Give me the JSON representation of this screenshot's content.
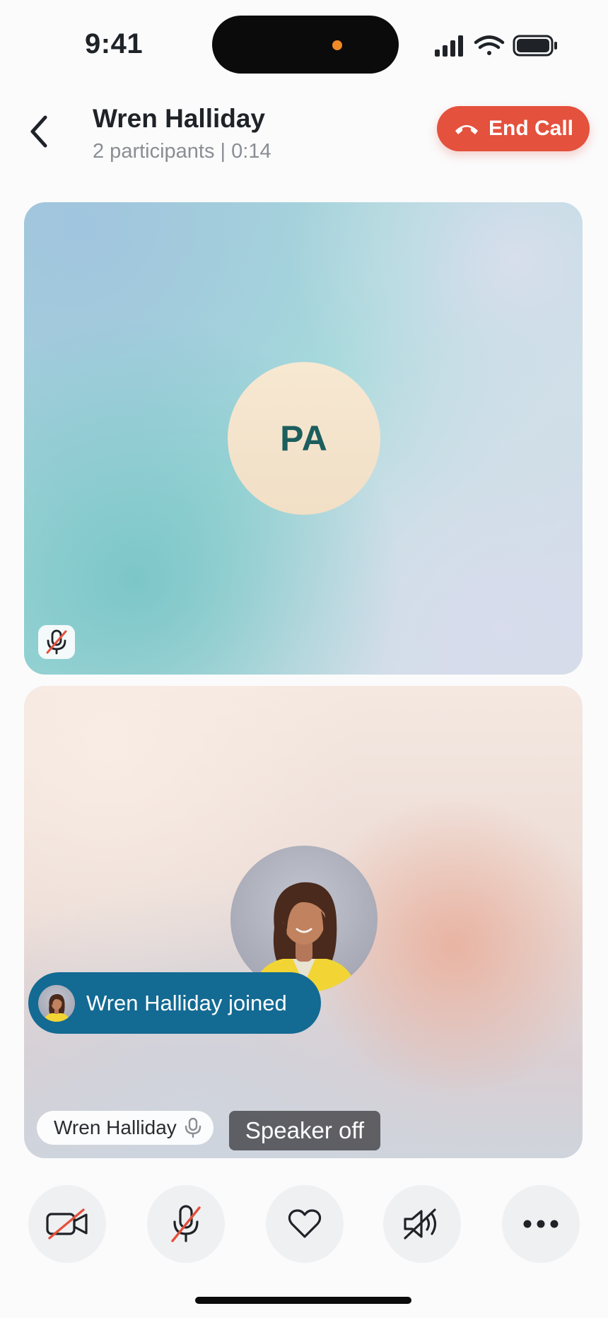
{
  "status_bar": {
    "time": "9:41"
  },
  "header": {
    "title": "Wren Halliday",
    "subtitle": "2 participants | 0:14",
    "end_call_label": "End Call"
  },
  "tiles": {
    "first": {
      "initials": "PA",
      "mic_state": "mic-off-icon"
    },
    "second": {
      "speaker_badge": "Speaker off",
      "name": "Wren Halliday"
    }
  },
  "toast": {
    "text": "Wren Halliday joined"
  },
  "controls": [
    {
      "name": "video-off-icon"
    },
    {
      "name": "mic-off-icon"
    },
    {
      "name": "heart-icon"
    },
    {
      "name": "speaker-off-icon"
    },
    {
      "name": "more-icon"
    }
  ],
  "colors": {
    "end_call": "#e4513d",
    "toast": "#136a93",
    "initials_text": "#1c5e5d",
    "slash": "#e4513d"
  }
}
